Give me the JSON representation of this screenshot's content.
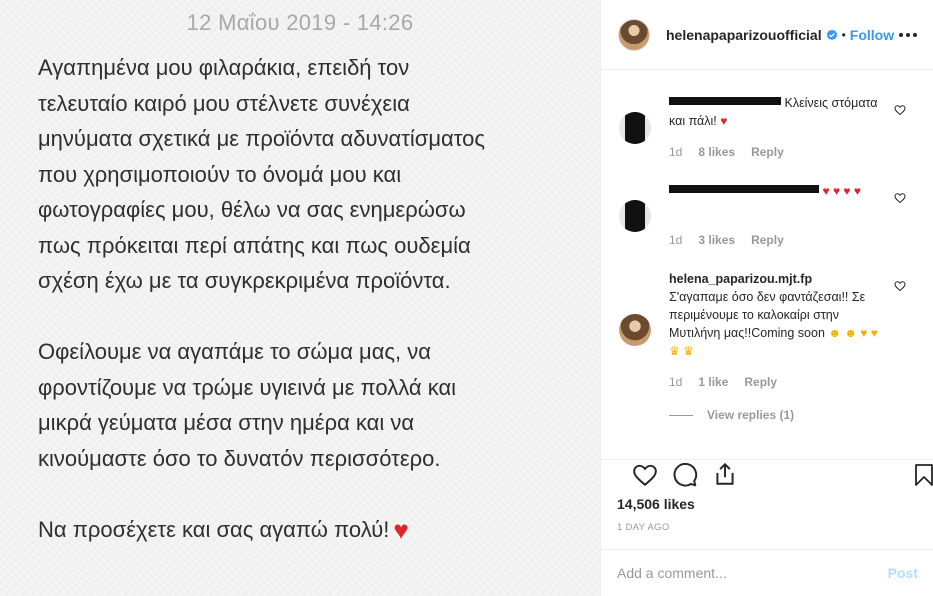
{
  "note": {
    "date": "12 Μαΐου 2019 - 14:26",
    "paragraphs": [
      "Αγαπημένα μου φιλαράκια, επειδή τον\nτελευταίο καιρό μου στέλνετε συνέχεια\nμηνύματα σχετικά με προϊόντα αδυνατίσματος\nπου χρησιμοποιούν το όνομά μου και\nφωτογραφίες μου, θέλω να σας ενημερώσω\nπως πρόκειται περί απάτης και πως ουδεμία\nσχέση έχω με τα συγκρεκριμένα προϊόντα.",
      "Οφείλουμε να αγαπάμε το σώμα μας, να\nφροντίζουμε να τρώμε υγιεινά με πολλά και\nμικρά γεύματα μέσα στην ημέρα και να\nκινούμαστε όσο το δυνατόν περισσότερο."
    ],
    "closing": "Να προσέχετε και σας αγαπώ πολύ!",
    "closing_emoji": "♥"
  },
  "header": {
    "username": "helenapaparizouofficial",
    "separator": "•",
    "follow_label": "Follow",
    "verified_icon": "verified-badge-icon",
    "more_icon": "more-options-icon"
  },
  "comments": [
    {
      "text": "Κλείνεις στόματα και πάλι!",
      "emojis": "♥",
      "age": "1d",
      "likes": "8 likes",
      "reply": "Reply"
    },
    {
      "text": "",
      "emojis": "♥ ♥ ♥ ♥",
      "age": "1d",
      "likes": "3 likes",
      "reply": "Reply"
    },
    {
      "username": "helena_paparizou.mjt.fp",
      "text": "Σ'αγαπαμε όσο δεν φαντάζεσαι!! Σε περιμένουμε το καλοκαίρι στην Μυτιλήνη μας!!Coming soon",
      "emojis": "☻ ☻ ♥ ♥ ♛ ♛",
      "age": "1d",
      "likes": "1 like",
      "reply": "Reply",
      "view_replies": "View replies (1)"
    }
  ],
  "actions": {
    "like_icon": "heart-icon",
    "comment_icon": "comment-icon",
    "share_icon": "share-icon",
    "save_icon": "bookmark-icon",
    "likes_count": "14,506 likes",
    "post_age": "1 DAY AGO"
  },
  "add_comment": {
    "placeholder": "Add a comment...",
    "post_label": "Post"
  },
  "colors": {
    "accent_blue": "#3897f0",
    "post_disabled": "#b2dffc",
    "heart_red": "#e0262b",
    "muted": "#999999"
  }
}
